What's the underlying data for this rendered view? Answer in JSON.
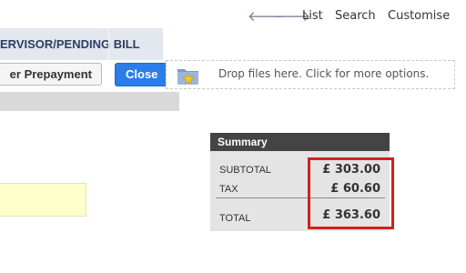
{
  "nav": {
    "back_icon": "arrow-left-icon",
    "forward_icon": "arrow-right-icon",
    "back_glyph": "🡐",
    "forward_glyph": "🡒",
    "list": "List",
    "search": "Search",
    "customise": "Customise"
  },
  "header": {
    "title": "ERVISOR/PENDING BILL"
  },
  "actions": {
    "prepayment_label": "er Prepayment",
    "close_label": "Close"
  },
  "dropzone": {
    "text": "Drop files here. Click for more options.",
    "icon": "folder-star-icon"
  },
  "summary": {
    "heading": "Summary",
    "subtotal_label": "SUBTOTAL",
    "subtotal_value": "£ 303.00",
    "tax_label": "TAX",
    "tax_value": "£ 60.60",
    "total_label": "TOTAL",
    "total_value": "£ 363.60"
  },
  "colors": {
    "accent": "#2b7de9",
    "highlight": "#d42020",
    "summary_header": "#444444"
  }
}
